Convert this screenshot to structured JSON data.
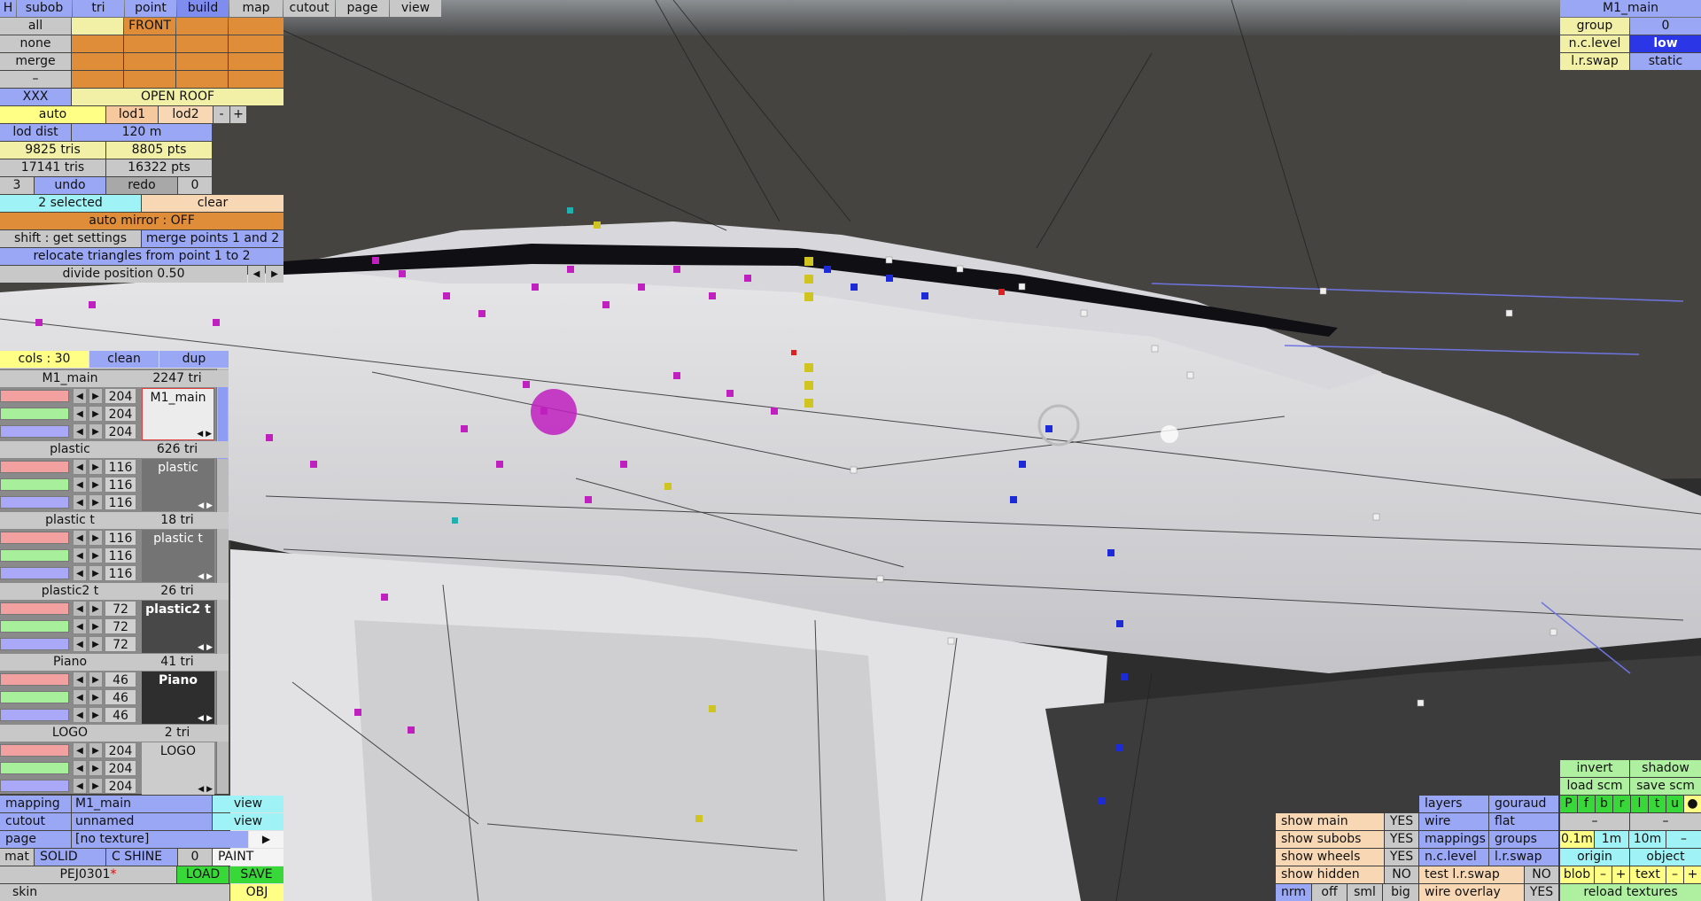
{
  "top_tabs": [
    "H",
    "subob",
    "tri",
    "point",
    "build",
    "map",
    "cutout",
    "page",
    "view"
  ],
  "left_top": {
    "row_labels": [
      "all",
      "none",
      "merge",
      "–",
      "XXX"
    ],
    "front_label": "FRONT",
    "open_roof_label": "OPEN ROOF",
    "auto_label": "auto",
    "lod1": "lod1",
    "lod2": "lod2",
    "minus": "-",
    "plus": "+",
    "lod_dist_label": "lod dist",
    "lod_dist_value": "120 m",
    "tris_1": "9825 tris",
    "pts_1": "8805 pts",
    "tris_2": "17141 tris",
    "pts_2": "16322 pts",
    "undo_count": "3",
    "undo": "undo",
    "redo": "redo",
    "redo_count": "0",
    "selected": "2 selected",
    "clear": "clear",
    "auto_mirror": "auto mirror : OFF",
    "shift_get": "shift : get settings",
    "merge_points": "merge points 1 and 2",
    "relocate": "relocate triangles from point 1 to 2",
    "divide_position": "divide position 0.50",
    "arrow_left": "◀",
    "arrow_right": "▶"
  },
  "materials_header": {
    "cols": "cols : 30",
    "clean": "clean",
    "dup": "dup"
  },
  "materials": [
    {
      "name": "M1_main",
      "tris": "2247 tri",
      "rgb": [
        "204",
        "204",
        "204"
      ],
      "swatch_label": "M1_main",
      "swatch_color": "#ececec",
      "swatch_text": "#111"
    },
    {
      "name": "plastic",
      "tris": "626 tri",
      "rgb": [
        "116",
        "116",
        "116"
      ],
      "swatch_label": "plastic",
      "swatch_color": "#747474",
      "swatch_text": "#fff"
    },
    {
      "name": "plastic t",
      "tris": "18 tri",
      "rgb": [
        "116",
        "116",
        "116"
      ],
      "swatch_label": "plastic t",
      "swatch_color": "#747474",
      "swatch_text": "#fff"
    },
    {
      "name": "plastic2 t",
      "tris": "26 tri",
      "rgb": [
        "72",
        "72",
        "72"
      ],
      "swatch_label": "plastic2 t",
      "swatch_color": "#484848",
      "swatch_text": "#fff"
    },
    {
      "name": "Piano",
      "tris": "41 tri",
      "rgb": [
        "46",
        "46",
        "46"
      ],
      "swatch_label": "Piano",
      "swatch_color": "#2e2e2e",
      "swatch_text": "#fff"
    },
    {
      "name": "LOGO",
      "tris": "2 tri",
      "rgb": [
        "204",
        "204",
        "204"
      ],
      "swatch_label": "LOGO",
      "swatch_color": "#cccccc",
      "swatch_text": "#111"
    }
  ],
  "bottom_left": {
    "mapping_label": "mapping",
    "mapping_value": "M1_main",
    "mapping_view": "view",
    "cutout_label": "cutout",
    "cutout_value": "unnamed",
    "cutout_view": "view",
    "page_label": "page",
    "page_value": "[no texture]",
    "page_arrow": "▶",
    "mat_label": "mat",
    "solid": "SOLID",
    "cshine": "C SHINE",
    "zero": "0",
    "paint": "PAINT",
    "file_name": "PEJ0301",
    "file_star": "*",
    "load": "LOAD",
    "save": "SAVE",
    "skin": "skin",
    "obj": "OBJ"
  },
  "top_right": {
    "title": "M1_main",
    "group_label": "group",
    "group_value": "0",
    "nclevel_label": "n.c.level",
    "nclevel_value": "low",
    "lrswap_label": "l.r.swap",
    "lrswap_value": "static"
  },
  "bottom_right": {
    "show_main": "show main",
    "show_main_v": "YES",
    "show_subobs": "show subobs",
    "show_subobs_v": "YES",
    "show_wheels": "show wheels",
    "show_wheels_v": "YES",
    "show_hidden": "show hidden",
    "show_hidden_v": "NO",
    "nrm": "nrm",
    "off": "off",
    "sml": "sml",
    "big": "big",
    "layers": "layers",
    "gouraud": "gouraud",
    "wire": "wire",
    "flat": "flat",
    "mappings": "mappings",
    "groups": "groups",
    "nclevel": "n.c.level",
    "lrswap": "l.r.swap",
    "test_lrswap": "test l.r.swap",
    "test_lrswap_v": "NO",
    "wire_overlay": "wire overlay",
    "wire_overlay_v": "YES",
    "invert": "invert",
    "shadow": "shadow",
    "load_scm": "load scm",
    "save_scm": "save scm",
    "pfbrltu": [
      "P",
      "f",
      "b",
      "r",
      "l",
      "t",
      "u",
      "●"
    ],
    "dash1": "–",
    "dash2": "–",
    "m01": "0.1m",
    "m1": "1m",
    "m10": "10m",
    "mminus": "–",
    "origin": "origin",
    "object": "object",
    "blob": "blob",
    "blob_minus": "–",
    "blob_plus": "+",
    "text": "text",
    "text_minus": "–",
    "text_plus": "+",
    "reload_textures": "reload textures"
  }
}
